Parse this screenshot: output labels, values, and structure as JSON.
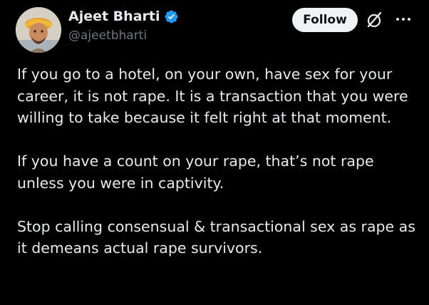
{
  "author": {
    "display_name": "Ajeet Bharti",
    "handle": "@ajeetbharti",
    "verified": true,
    "avatar_icon": "avatar-photo"
  },
  "actions": {
    "follow_label": "Follow",
    "grok_icon": "grok-icon",
    "more_icon": "more-options-icon"
  },
  "tweet": {
    "paragraphs": [
      "If you go to a hotel, on your own, have sex for your career, it is not rape. It is a transaction that you were willing to take because it felt right at that moment.",
      "If you have a count on your rape, that’s not rape unless you were in captivity.",
      "Stop calling consensual & transactional sex as rape as it demeans actual rape survivors."
    ]
  },
  "colors": {
    "background": "#000000",
    "text_primary": "#e7e9ea",
    "text_secondary": "#71767b",
    "verified_badge": "#1d9bf0",
    "follow_button_bg": "#eff3f4"
  }
}
